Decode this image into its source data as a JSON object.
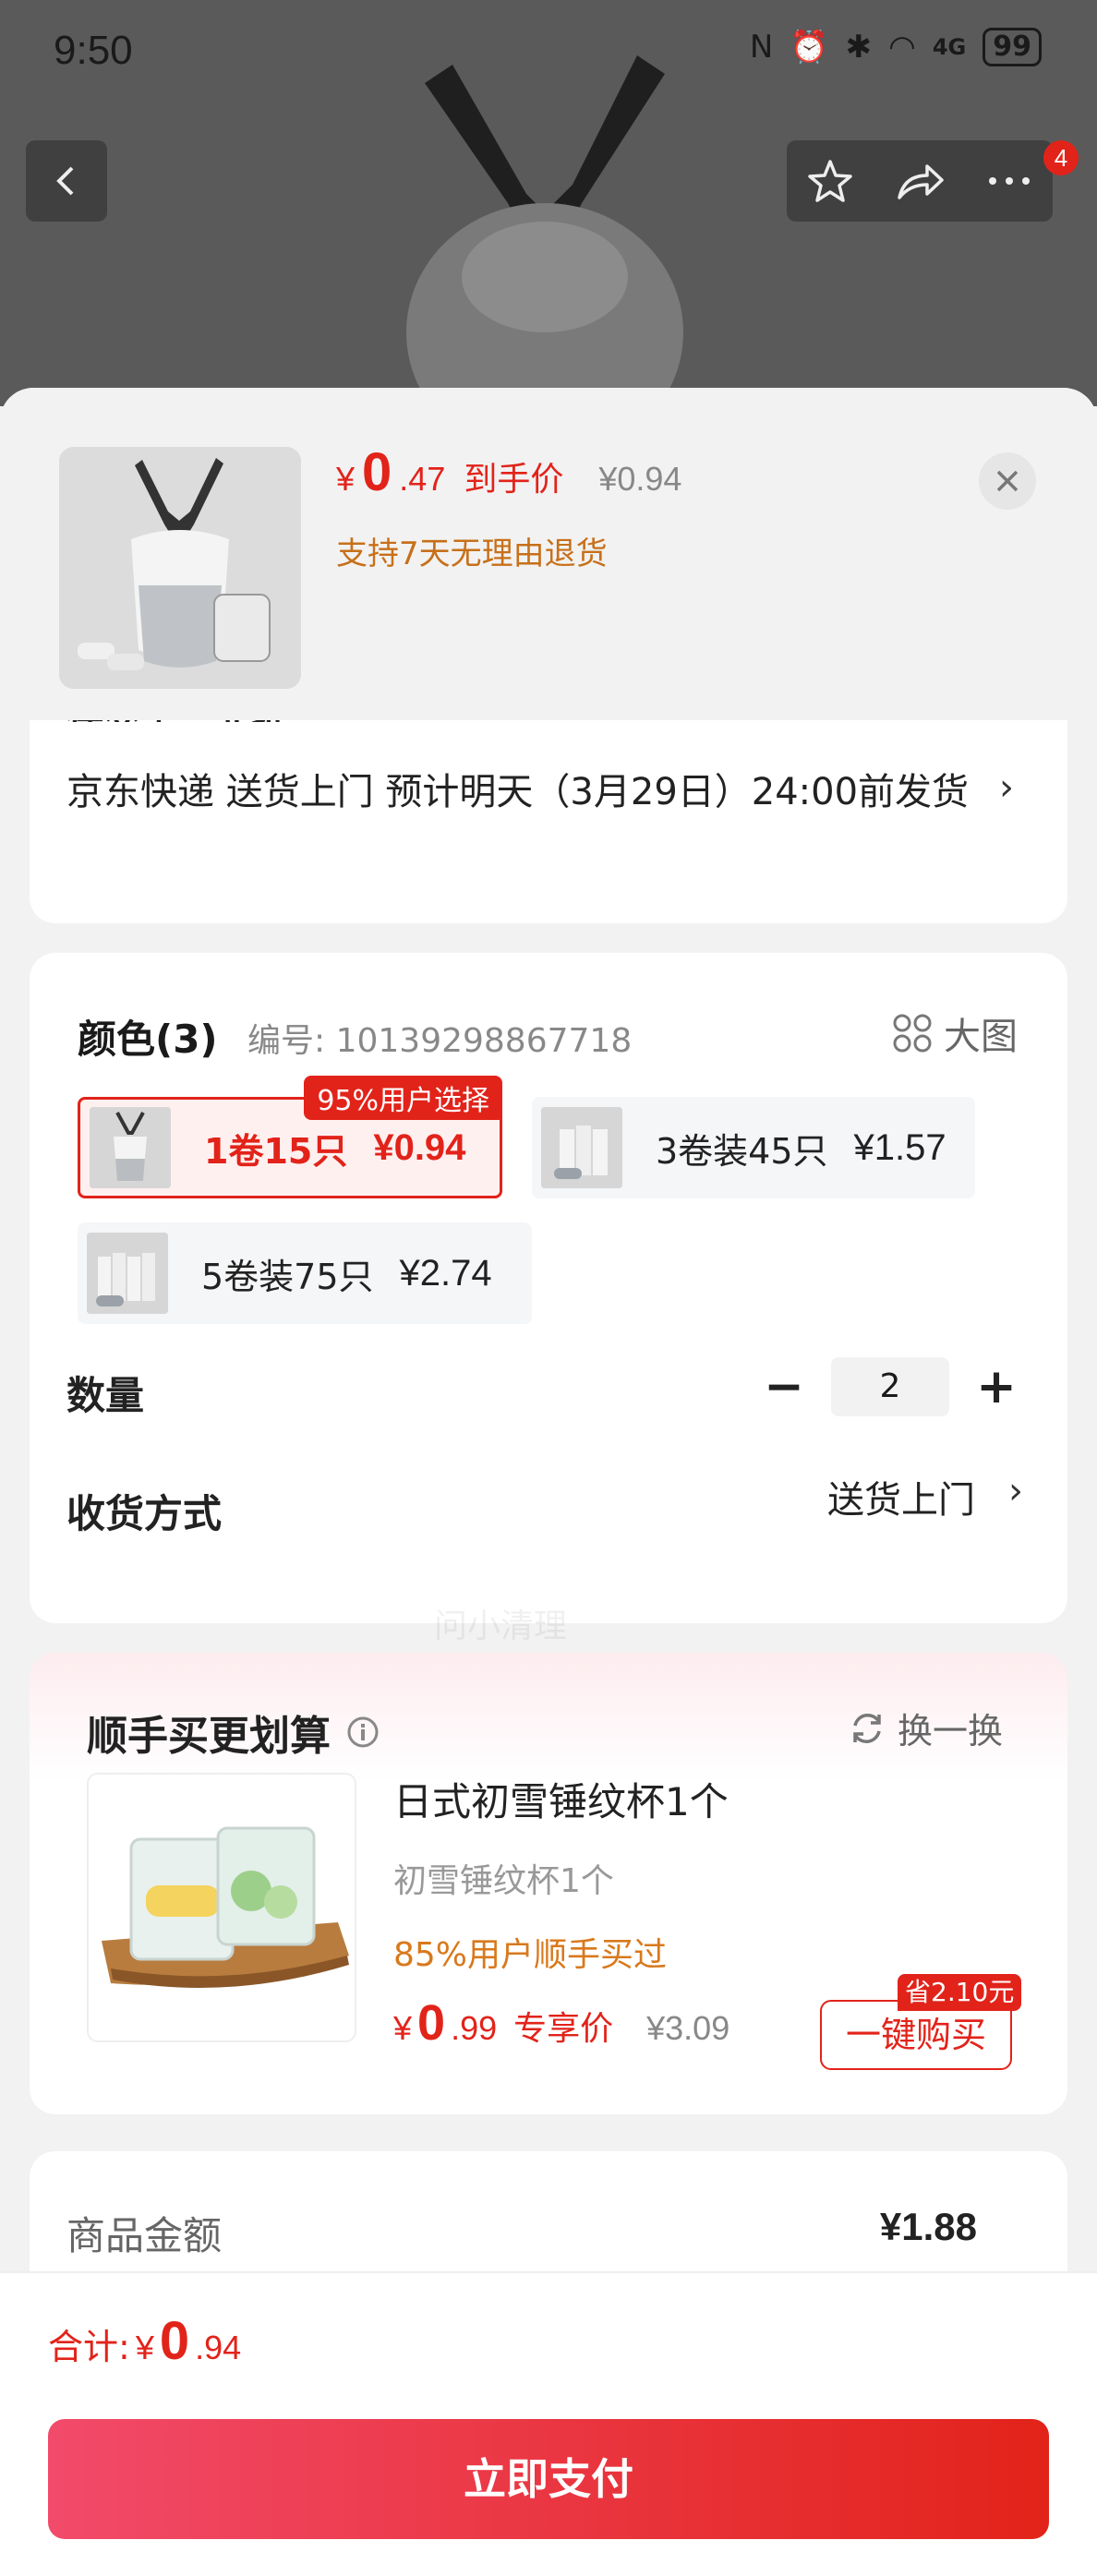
{
  "status_bar": {
    "time": "9:50",
    "battery": "99",
    "signal": "4G"
  },
  "top_badge": "4",
  "sheet_header": {
    "currency": "¥",
    "price_int": "0",
    "price_dec": ".47",
    "price_tag": "到手价",
    "original_price": "¥0.94",
    "return_note": "支持7天无理由退货"
  },
  "delivery": {
    "cut_text": "任交至 “北推",
    "text": "京东快递 送货上门 预计明天（3月29日）24:00前发货"
  },
  "color_section": {
    "title": "颜色(3)",
    "code": "编号: 10139298867718",
    "big_pic_label": "大图",
    "options": [
      {
        "label": "1卷15只",
        "price": "¥0.94",
        "badge": "95%用户选择",
        "selected": true
      },
      {
        "label": "3卷装45只",
        "price": "¥1.57",
        "selected": false
      },
      {
        "label": "5卷装75只",
        "price": "¥2.74",
        "selected": false
      }
    ],
    "quantity_label": "数量",
    "quantity_value": "2",
    "minus": "−",
    "plus": "+",
    "shipping_label": "收货方式",
    "shipping_value": "送货上门"
  },
  "addon": {
    "title": "顺手买更划算",
    "refresh_label": "换一换",
    "product_name": "日式初雪锤纹杯1个",
    "product_sub": "初雪锤纹杯1个",
    "stat": "85%用户顺手买过",
    "price_int": "0",
    "price_dec": ".99",
    "price_tag": "专享价",
    "original_price": "¥3.09",
    "save_badge": "省2.10元",
    "buy_label": "一键购买"
  },
  "amount": {
    "label": "商品金额",
    "value": "¥1.88"
  },
  "bottom": {
    "total_label": "合计:",
    "currency": "¥",
    "total_int": "0",
    "total_dec": ".94",
    "pay_label": "立即支付"
  },
  "watermark": "问小清理",
  "colors": {
    "accent": "#e2231a",
    "orange": "#d8791c",
    "pink_bg": "#fdecef"
  }
}
